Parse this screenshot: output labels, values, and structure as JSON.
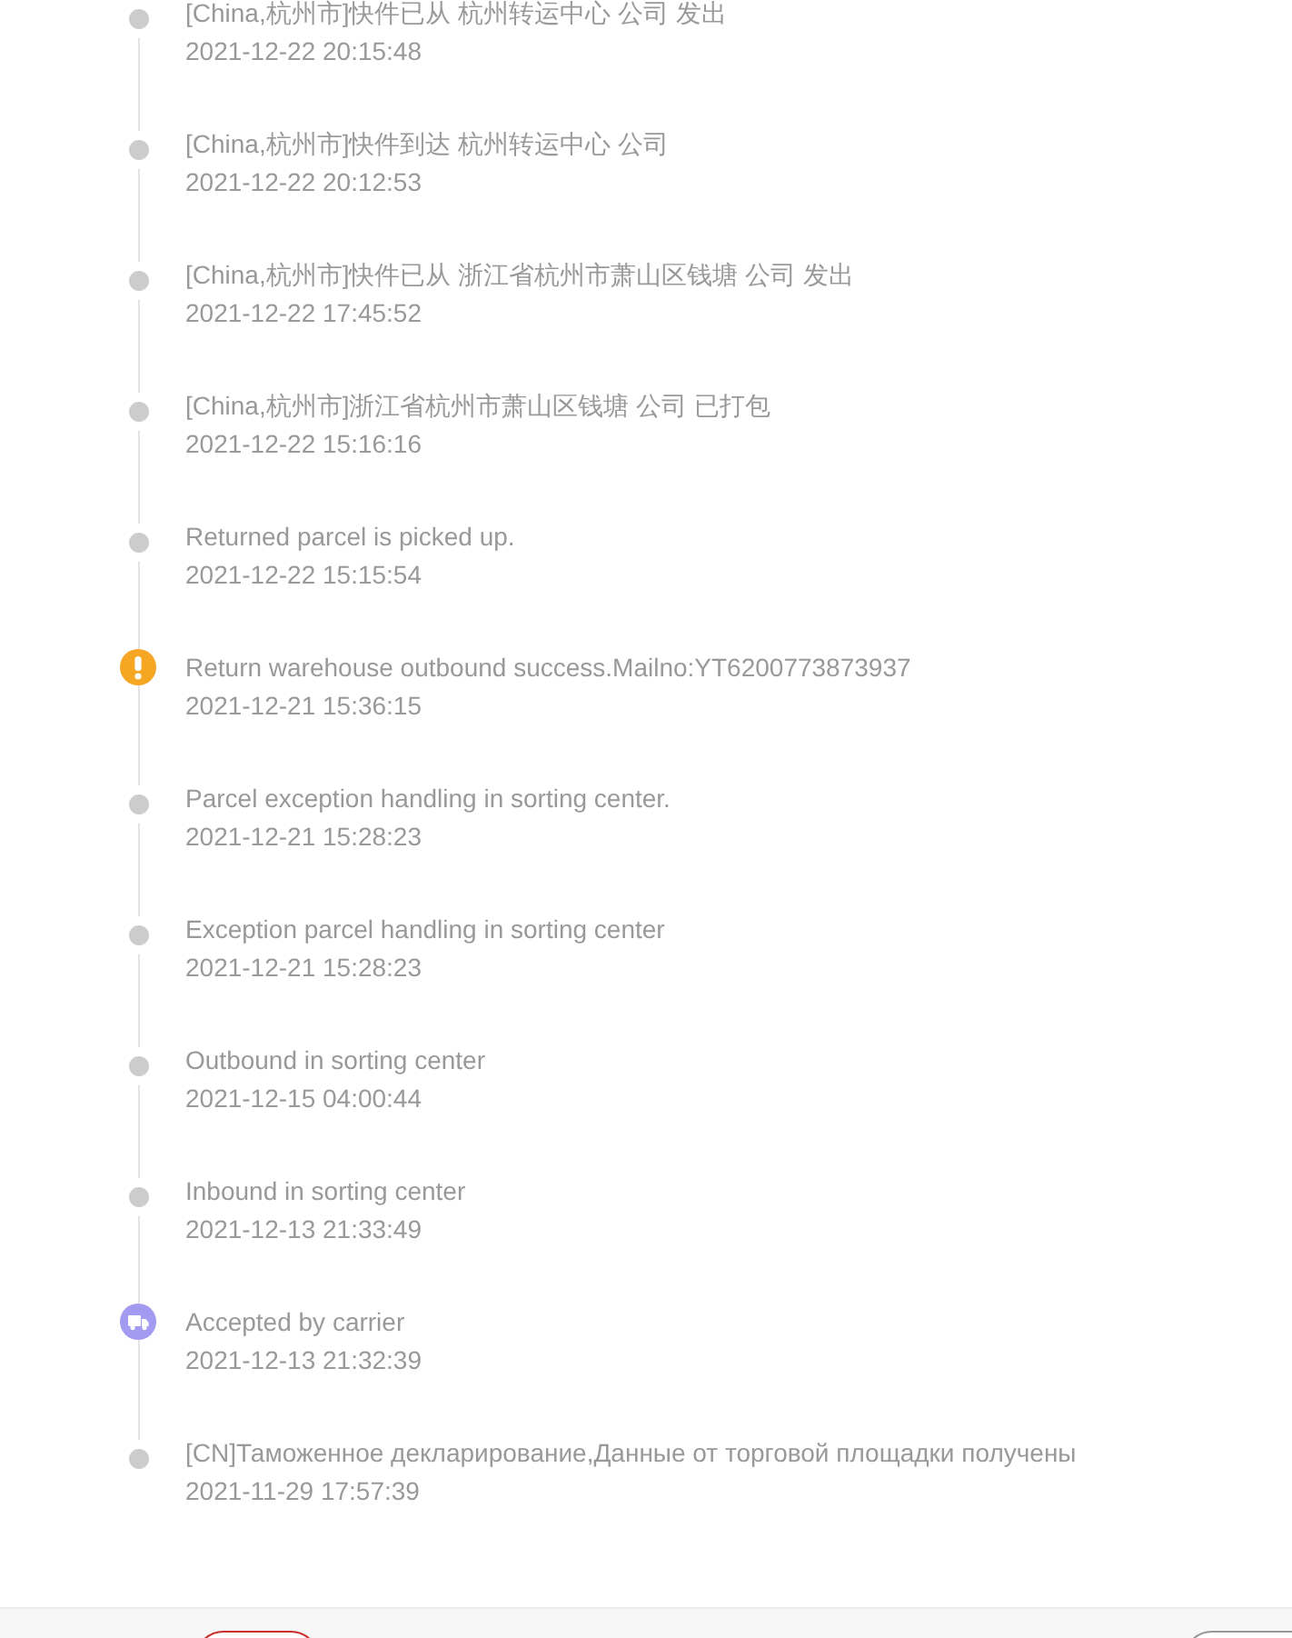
{
  "timeline": [
    {
      "kind": "dot",
      "title": "[China,杭州市]快件已从 杭州转运中心 公司 发出",
      "time": "2021-12-22 20:15:48"
    },
    {
      "kind": "dot",
      "title": "[China,杭州市]快件到达 杭州转运中心 公司",
      "time": "2021-12-22 20:12:53"
    },
    {
      "kind": "dot",
      "title": "[China,杭州市]快件已从 浙江省杭州市萧山区钱塘 公司 发出",
      "time": "2021-12-22 17:45:52"
    },
    {
      "kind": "dot",
      "title": "[China,杭州市]浙江省杭州市萧山区钱塘 公司 已打包",
      "time": "2021-12-22 15:16:16"
    },
    {
      "kind": "dot",
      "title": "Returned parcel is picked up.",
      "time": "2021-12-22 15:15:54"
    },
    {
      "kind": "warning",
      "title": "Return warehouse outbound success.Mailno:YT6200773873937",
      "time": "2021-12-21 15:36:15"
    },
    {
      "kind": "dot",
      "title": "Parcel exception handling in sorting center.",
      "time": "2021-12-21 15:28:23"
    },
    {
      "kind": "dot",
      "title": "Exception parcel handling in sorting center",
      "time": "2021-12-21 15:28:23"
    },
    {
      "kind": "dot",
      "title": "Outbound in sorting center",
      "time": "2021-12-15 04:00:44"
    },
    {
      "kind": "dot",
      "title": "Inbound in sorting center",
      "time": "2021-12-13 21:33:49"
    },
    {
      "kind": "truck",
      "title": "Accepted by carrier",
      "time": "2021-12-13 21:32:39"
    },
    {
      "kind": "dot",
      "title": "[CN]Таможенное декларирование,Данные от торговой площадки получены",
      "time": "2021-11-29 17:57:39"
    }
  ],
  "bottom_bar": {
    "buttons": [
      {
        "kind": "danger"
      },
      {
        "kind": "default"
      }
    ]
  }
}
